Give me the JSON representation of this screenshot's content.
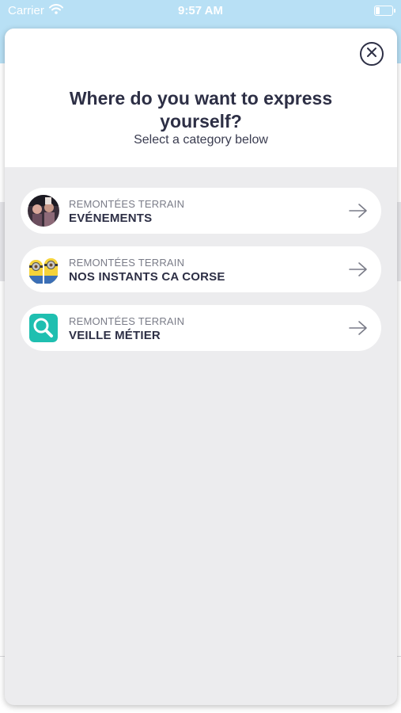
{
  "status_bar": {
    "carrier": "Carrier",
    "time": "9:57 AM",
    "wifi_icon": "wifi-icon",
    "battery_icon": "battery-icon"
  },
  "modal": {
    "close_icon": "close-icon",
    "title": "Where do you want to express yourself?",
    "subtitle": "Select a category below",
    "categories": [
      {
        "kicker": "REMONTÉES TERRAIN",
        "title": "EVÉNEMENTS",
        "icon": "event-photo-icon",
        "arrow": "arrow-right-icon"
      },
      {
        "kicker": "REMONTÉES TERRAIN",
        "title": "NOS INSTANTS CA CORSE",
        "icon": "minions-icon",
        "arrow": "arrow-right-icon"
      },
      {
        "kicker": "REMONTÉES TERRAIN",
        "title": "VEILLE MÉTIER",
        "icon": "search-icon",
        "arrow": "arrow-right-icon"
      }
    ]
  },
  "colors": {
    "header_bg": "#b8e0f5",
    "title_text": "#2d2f45",
    "sheet_bg": "#ececee",
    "search_tile": "#1fbfb0"
  }
}
